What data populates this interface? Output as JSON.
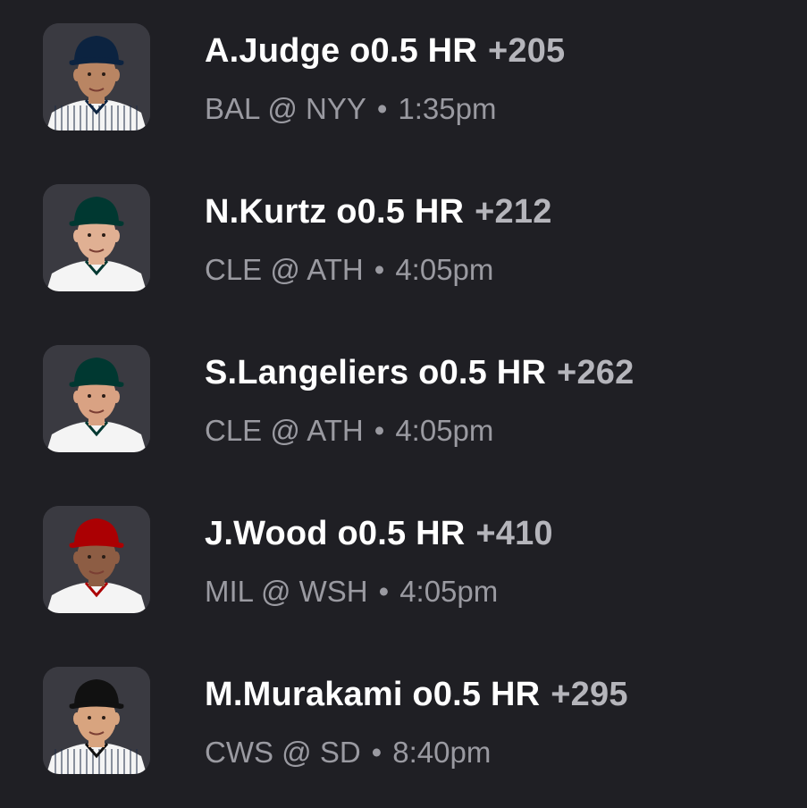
{
  "props": [
    {
      "player": "A.Judge",
      "market": "o0.5 HR",
      "odds": "+205",
      "matchup": "BAL @ NYY",
      "separator": "•",
      "time": "1:35pm",
      "cap_color": "#0c2340",
      "cap_logo": "NY",
      "jersey": "pinstripe",
      "jersey_color": "#f4f4f4",
      "trim_color": "#0c2340",
      "skin_color": "#b98563"
    },
    {
      "player": "N.Kurtz",
      "market": "o0.5 HR",
      "odds": "+212",
      "matchup": "CLE @ ATH",
      "separator": "•",
      "time": "4:05pm",
      "cap_color": "#003831",
      "cap_logo": "A's",
      "jersey": "plain",
      "jersey_color": "#f4f4f4",
      "trim_color": "#003831",
      "skin_color": "#e0b093"
    },
    {
      "player": "S.Langeliers",
      "market": "o0.5 HR",
      "odds": "+262",
      "matchup": "CLE @ ATH",
      "separator": "•",
      "time": "4:05pm",
      "cap_color": "#003831",
      "cap_logo": "A's",
      "jersey": "plain",
      "jersey_color": "#f4f4f4",
      "trim_color": "#003831",
      "skin_color": "#d9a283"
    },
    {
      "player": "J.Wood",
      "market": "o0.5 HR",
      "odds": "+410",
      "matchup": "MIL @ WSH",
      "separator": "•",
      "time": "4:05pm",
      "cap_color": "#ab0003",
      "cap_logo": "W",
      "jersey": "plain",
      "jersey_color": "#f4f4f4",
      "trim_color": "#ab0003",
      "skin_color": "#8d5d44"
    },
    {
      "player": "M.Murakami",
      "market": "o0.5 HR",
      "odds": "+295",
      "matchup": "CWS @ SD",
      "separator": "•",
      "time": "8:40pm",
      "cap_color": "#111111",
      "cap_logo": "SOX",
      "jersey": "pinstripe",
      "jersey_color": "#f4f4f4",
      "trim_color": "#111111",
      "skin_color": "#d8a47f"
    }
  ]
}
